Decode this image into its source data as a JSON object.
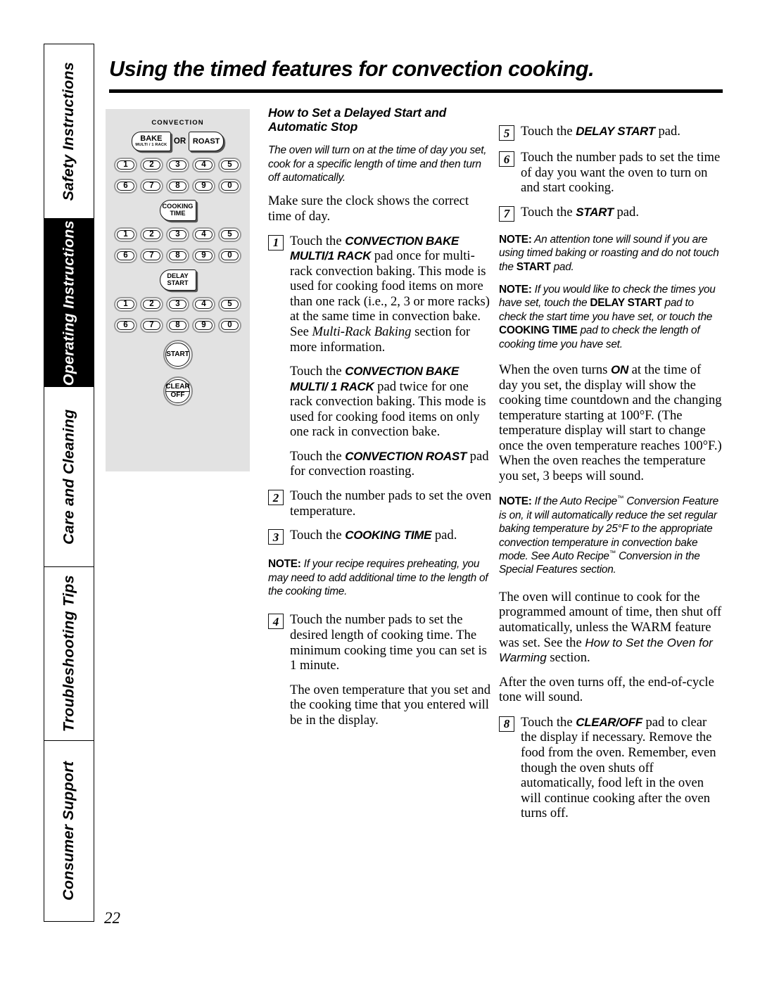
{
  "page": {
    "number": "22",
    "title": "Using the timed features for convection cooking."
  },
  "sidebar": {
    "tabs": [
      {
        "label": "Safety Instructions",
        "active": false
      },
      {
        "label": "Operating Instructions",
        "active": true
      },
      {
        "label": "Care and Cleaning",
        "active": false
      },
      {
        "label": "Troubleshooting Tips",
        "active": false
      },
      {
        "label": "Consumer Support",
        "active": false
      }
    ]
  },
  "control_panel": {
    "heading": "CONVECTION",
    "bake_label": "BAKE",
    "bake_sublabel": "MULTI / 1 RACK",
    "or_label": "OR",
    "roast_label": "ROAST",
    "number_rows": [
      [
        "1",
        "2",
        "3",
        "4",
        "5"
      ],
      [
        "6",
        "7",
        "8",
        "9",
        "0"
      ],
      [
        "1",
        "2",
        "3",
        "4",
        "5"
      ],
      [
        "6",
        "7",
        "8",
        "9",
        "0"
      ],
      [
        "1",
        "2",
        "3",
        "4",
        "5"
      ],
      [
        "6",
        "7",
        "8",
        "9",
        "0"
      ]
    ],
    "cooking_time_line1": "COOKING",
    "cooking_time_line2": "TIME",
    "delay_start_line1": "DELAY",
    "delay_start_line2": "START",
    "start_label": "START",
    "clear_line1": "CLEAR",
    "clear_line2": "OFF"
  },
  "content": {
    "section_heading": "How to Set a Delayed Start and Automatic Stop",
    "intro_italic": "The oven will turn on at the time of day you set, cook for a specific length of time and then turn off automatically.",
    "clock_paragraph": "Make sure the clock shows the correct time of day.",
    "step1": {
      "number": "1",
      "lead": "Touch the",
      "pad": "CONVECTION BAKE MULTI/1 RACK",
      "body_a": "pad once for multi-rack convection baking. This mode is used for cooking food items on more than one rack (i.e., 2, 3 or more racks) at the same time in convection bake. See",
      "italic_ref": "Multi-Rack Baking",
      "body_b": "section for more information."
    },
    "step1_cont": {
      "lead": "Touch the",
      "pad": "CONVECTION BAKE MULTI/ 1 RACK",
      "body": "pad twice for one rack convection baking. This mode is used for cooking food items on only one rack in convection bake."
    },
    "roast_paragraph": {
      "lead": "Touch the",
      "pad": "CONVECTION ROAST",
      "body": "pad for convection roasting."
    },
    "step2": {
      "number": "2",
      "text": "Touch the number pads to set the oven temperature."
    },
    "step3": {
      "number": "3",
      "lead": "Touch the",
      "pad": "COOKING TIME",
      "body": "pad."
    },
    "note_preheat": {
      "label": "NOTE:",
      "text": "If your recipe requires preheating, you may need to add additional time to the length of the cooking time."
    },
    "step4": {
      "number": "4",
      "text": "Touch the number pads to set the desired length of cooking time. The minimum cooking time you can set is 1 minute."
    },
    "step4_cont": "The oven temperature that you set and the cooking time that you entered will be in the display.",
    "step5": {
      "number": "5",
      "lead": "Touch the",
      "pad": "DELAY START",
      "body": "pad."
    },
    "step6": {
      "number": "6",
      "text": "Touch the number pads to set the time of day you want the oven to turn on and start cooking."
    },
    "step7": {
      "number": "7",
      "lead": "Touch the",
      "pad": "START",
      "body": "pad."
    },
    "note_tone": {
      "label": "NOTE:",
      "text_a": "An attention tone will sound if you are using timed baking or roasting and do not touch the",
      "pad": "START",
      "text_b": "pad."
    },
    "note_check": {
      "label": "NOTE:",
      "text_a": "If you would like to check the times you have set, touch the",
      "pad_a": "DELAY START",
      "text_b": "pad to check the start time you have set, or touch the",
      "pad_b": "COOKING TIME",
      "text_c": "pad to check the length of cooking time you have set."
    },
    "oven_on_paragraph": {
      "text_a": "When the oven turns",
      "on_word": "ON",
      "text_b": "at the time of day you set, the display will show the cooking time countdown and the changing temperature starting at 100°F. (The temperature display will start to change once the oven temperature reaches 100°F.) When the oven reaches the temperature you set, 3 beeps will sound."
    },
    "note_auto_recipe": {
      "label": "NOTE:",
      "text_a": "If the Auto Recipe",
      "tm": "™",
      "text_b": "Conversion Feature is on, it will automatically reduce the set regular baking temperature by 25°F to the appropriate convection temperature in convection bake mode. See Auto Recipe",
      "text_c": "Conversion in the Special Features section."
    },
    "continue_paragraph": {
      "text_a": "The oven will continue to cook for the programmed amount of time, then shut off automatically, unless the WARM feature was set. See the",
      "italic_ref": "How to Set the Oven for Warming",
      "text_b": "section."
    },
    "end_tone_paragraph": "After the oven turns off, the end-of-cycle tone will sound.",
    "step8": {
      "number": "8",
      "lead": "Touch the",
      "pad": "CLEAR/OFF",
      "body": "pad to clear the display if necessary. Remove the food from the oven. Remember, even though the oven shuts off automatically, food left in the oven will continue cooking after the oven turns off."
    }
  }
}
